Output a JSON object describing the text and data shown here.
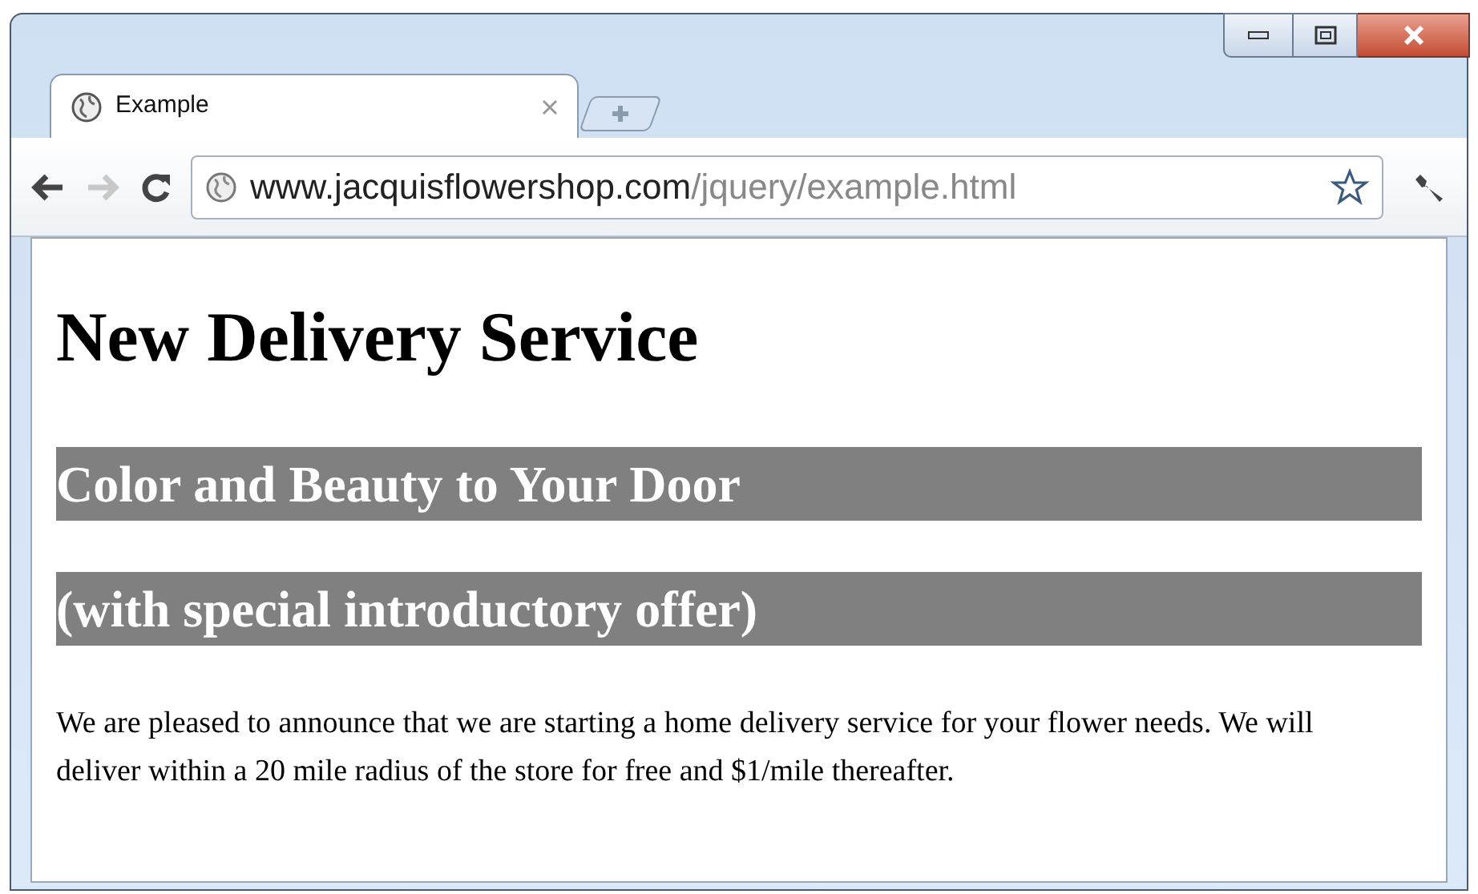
{
  "tabs": [
    {
      "title": "Example",
      "selected": true
    }
  ],
  "address": {
    "host": "www.jacquisflowershop.com",
    "path": "/jquery/example.html"
  },
  "content": [
    {
      "kind": "h1",
      "text": "New Delivery Service"
    },
    {
      "kind": "h2",
      "text": "Color and Beauty to Your Door"
    },
    {
      "kind": "h2",
      "text": "(with special introductory offer)"
    },
    {
      "kind": "p",
      "text": "We are pleased to announce that we are starting a home delivery service for your flower needs. We will deliver within a 20 mile radius of the store for free and $1/mile thereafter."
    }
  ]
}
